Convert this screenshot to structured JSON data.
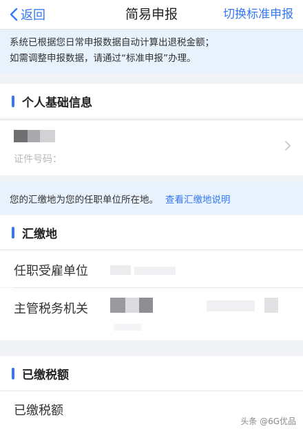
{
  "nav": {
    "back_label": "返回",
    "title": "简易申报",
    "right_action": "切换标准申报"
  },
  "notice": {
    "line1": "系统已根据您日常申报数据自动计算出退税金额；",
    "line2": "如需调整申报数据，请通过“标准申报”办理。"
  },
  "personal_section": {
    "title": "个人基础信息",
    "id_label": "证件号码："
  },
  "payment_info": {
    "text": "您的汇缴地为您的任职单位所在地。",
    "link": "查看汇缴地说明"
  },
  "payment_place_section": {
    "title": "汇缴地",
    "fields": [
      {
        "label": "任职受雇单位"
      },
      {
        "label": "主管税务机关"
      }
    ]
  },
  "tax_paid_section": {
    "title": "已缴税额",
    "field_label": "已缴税额"
  },
  "watermark": "头条 @6G优品",
  "colors": {
    "accent": "#3478f6",
    "notice_bg": "#e8f2fd",
    "page_bg": "#f2f3f7"
  }
}
